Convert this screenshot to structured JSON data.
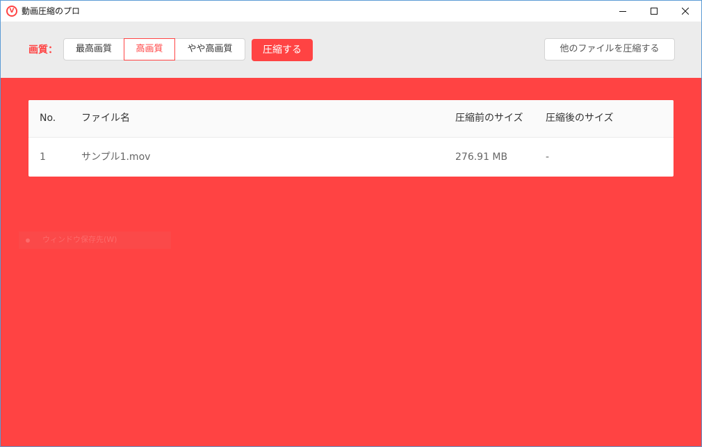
{
  "window": {
    "title": "動画圧縮のプロ",
    "logo_letter": "V",
    "accent_color": "#ff4343"
  },
  "toolbar": {
    "quality_label": "画質：",
    "quality_options": [
      "最高画質",
      "高画質",
      "やや高画質"
    ],
    "selected_quality": "高画質",
    "compress_button": "圧縮する",
    "other_files_button": "他のファイルを圧縮する"
  },
  "table": {
    "columns": [
      "No.",
      "ファイル名",
      "圧縮前のサイズ",
      "圧縮後のサイズ"
    ],
    "rows": [
      {
        "no": "1",
        "name": "サンプル1.mov",
        "size_before": "276.91 MB",
        "size_after": "-"
      }
    ]
  },
  "faint_overlay": {
    "text": "ウィンドウ保存先(W)"
  }
}
